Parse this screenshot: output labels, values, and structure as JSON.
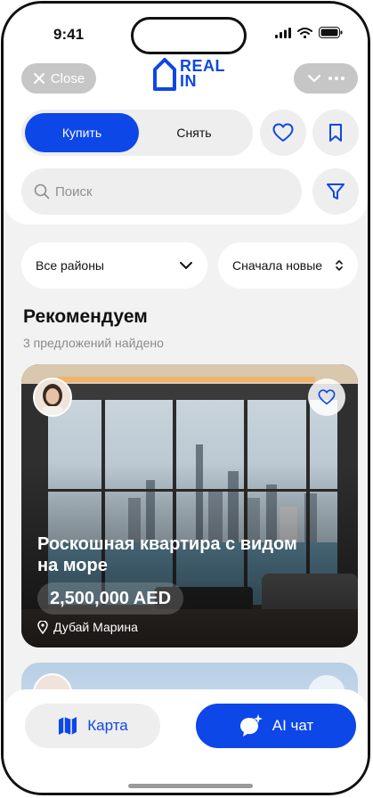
{
  "status_bar": {
    "time": "9:41"
  },
  "header": {
    "close_label": "Close",
    "logo": "REAL IN",
    "icons": [
      "close-icon",
      "chevron-down-icon",
      "more-icon",
      "home-outline-icon"
    ]
  },
  "mode_tabs": [
    {
      "label": "Купить",
      "active": true
    },
    {
      "label": "Снять",
      "active": false
    }
  ],
  "search": {
    "placeholder": "Поиск",
    "value": ""
  },
  "filters": {
    "district": "Все районы",
    "sort": "Сначала новые"
  },
  "section": {
    "title": "Рекомендуем",
    "subtitle": "3 предложений найдено"
  },
  "listing": {
    "title": "Роскошная квартира с видом на море",
    "price": "2,500,000 AED",
    "location": "Дубай Марина"
  },
  "bottom_nav": {
    "map_label": "Карта",
    "ai_label": "AI чат"
  },
  "colors": {
    "accent": "#0d47e8",
    "surface": "#eeeeee",
    "background": "#f2f2f2"
  }
}
